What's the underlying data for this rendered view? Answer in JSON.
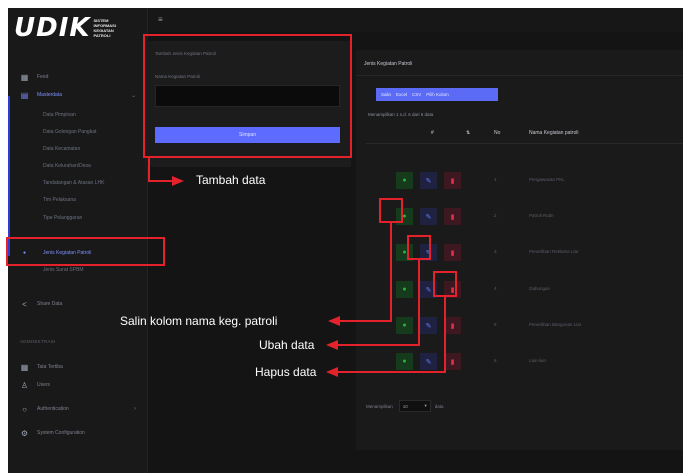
{
  "logo": {
    "main": "UDIK",
    "sub": [
      "SISTEM",
      "INFORMASI",
      "KEGIATAN",
      "PATROLI"
    ]
  },
  "sidebar": {
    "items": [
      {
        "label": "Feed",
        "icon": "grid-icon"
      },
      {
        "label": "Masterdata",
        "icon": "layers-icon"
      },
      {
        "label": "Data Pimpinan"
      },
      {
        "label": "Data Golongan Pangkat"
      },
      {
        "label": "Data Kecamatan"
      },
      {
        "label": "Data Kelurahan/Desa"
      },
      {
        "label": "Tandatangan & Atasan LHK"
      },
      {
        "label": "Tim Pelaksana"
      },
      {
        "label": "Tipe Pelanggaran"
      },
      {
        "label": "Jenis Kegiatan Patroli"
      },
      {
        "label": "Jenis Surat SPBM"
      },
      {
        "label": "Share Data",
        "icon": "share-icon"
      }
    ],
    "section_label": "ADMINISTRASI",
    "admin_items": [
      {
        "label": "Tata Tertiba",
        "icon": "user-group-icon"
      },
      {
        "label": "Users",
        "icon": "user-icon"
      },
      {
        "label": "Authentication",
        "icon": "lock-icon"
      },
      {
        "label": "System Configuration",
        "icon": "gear-icon"
      }
    ]
  },
  "form": {
    "subtitle": "Tambah Jenis Kegiatan Patroli",
    "field_label": "Nama Kegiatan Patroli",
    "input_value": "",
    "submit_label": "Simpan"
  },
  "table": {
    "title": "Jenis Kegiatan Patroli",
    "export_buttons": [
      "Salin",
      "Excel",
      "CSV",
      "Pilih Kolom"
    ],
    "showing_text": "Menampilkan 1 s.d. 6 dari 6 data",
    "headers": {
      "aksi": "#",
      "no": "No",
      "nama": "Nama Kegiatan patroli"
    },
    "rows": [
      {
        "no": "1",
        "nama": "Pengawasan PKL"
      },
      {
        "no": "2",
        "nama": "Patroli Rutin"
      },
      {
        "no": "3",
        "nama": "Penertiban Reklame Liar"
      },
      {
        "no": "4",
        "nama": "Gabungan"
      },
      {
        "no": "5",
        "nama": "Penertiban Bangunan Liar"
      },
      {
        "no": "6",
        "nama": "Lain-lain"
      }
    ],
    "footer_before": "Menampilkan",
    "page_size": "10",
    "footer_after": "data"
  },
  "callouts": {
    "tambah": "Tambah data",
    "salin": "Salin kolom nama keg. patroli",
    "ubah": "Ubah data",
    "hapus": "Hapus data"
  },
  "colors": {
    "annotation_red": "#e3222c",
    "accent": "#5d6cff",
    "copy_green": "#24b43a",
    "edit_blue": "#6a7cff",
    "delete_red": "#e0304a"
  }
}
